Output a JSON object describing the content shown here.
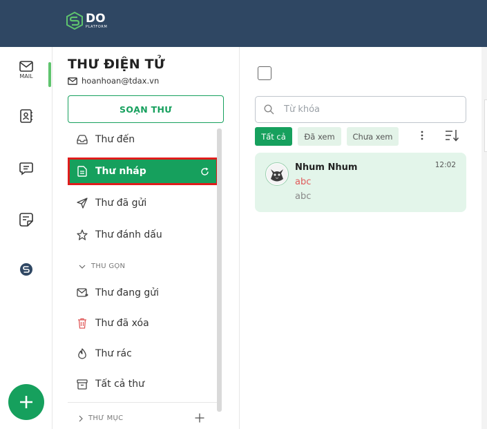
{
  "brand": {
    "logo_text": "DO",
    "logo_sub": "PLATFORM"
  },
  "rail": {
    "items": [
      {
        "label": "MAIL",
        "icon": "mail-icon"
      },
      {
        "label": "",
        "icon": "contacts-icon"
      },
      {
        "label": "",
        "icon": "chat-icon"
      },
      {
        "label": "",
        "icon": "notes-icon"
      },
      {
        "label": "",
        "icon": "platform-logo-icon"
      }
    ],
    "fab_icon": "plus-icon"
  },
  "panel": {
    "title": "THƯ ĐIỆN TỬ",
    "email": "hoanhoan@tdax.vn",
    "compose_label": "SOẠN THƯ",
    "folders": [
      {
        "label": "Thư đến",
        "icon": "inbox-icon"
      },
      {
        "label": "Thư nháp",
        "icon": "draft-icon",
        "active": true
      },
      {
        "label": "Thư đã gửi",
        "icon": "send-icon"
      },
      {
        "label": "Thư đánh dấu",
        "icon": "star-icon"
      }
    ],
    "collapse_label": "THU GỌN",
    "more_folders": [
      {
        "label": "Thư đang gửi",
        "icon": "outbox-icon"
      },
      {
        "label": "Thư đã xóa",
        "icon": "trash-icon"
      },
      {
        "label": "Thư rác",
        "icon": "spam-icon"
      },
      {
        "label": "Tất cả thư",
        "icon": "archive-icon"
      }
    ],
    "folders_section_label": "THƯ MỤC"
  },
  "list": {
    "search_placeholder": "Từ khóa",
    "filters": [
      {
        "label": "Tất cả",
        "selected": true
      },
      {
        "label": "Đã xem",
        "selected": false
      },
      {
        "label": "Chưa xem",
        "selected": false
      }
    ],
    "messages": [
      {
        "sender": "Nhum Nhum",
        "subject": "abc",
        "snippet": "abc",
        "time": "12:02"
      }
    ]
  },
  "colors": {
    "accent": "#16a05d",
    "topbar": "#2f4763",
    "highlight_border": "#e01b1b"
  }
}
